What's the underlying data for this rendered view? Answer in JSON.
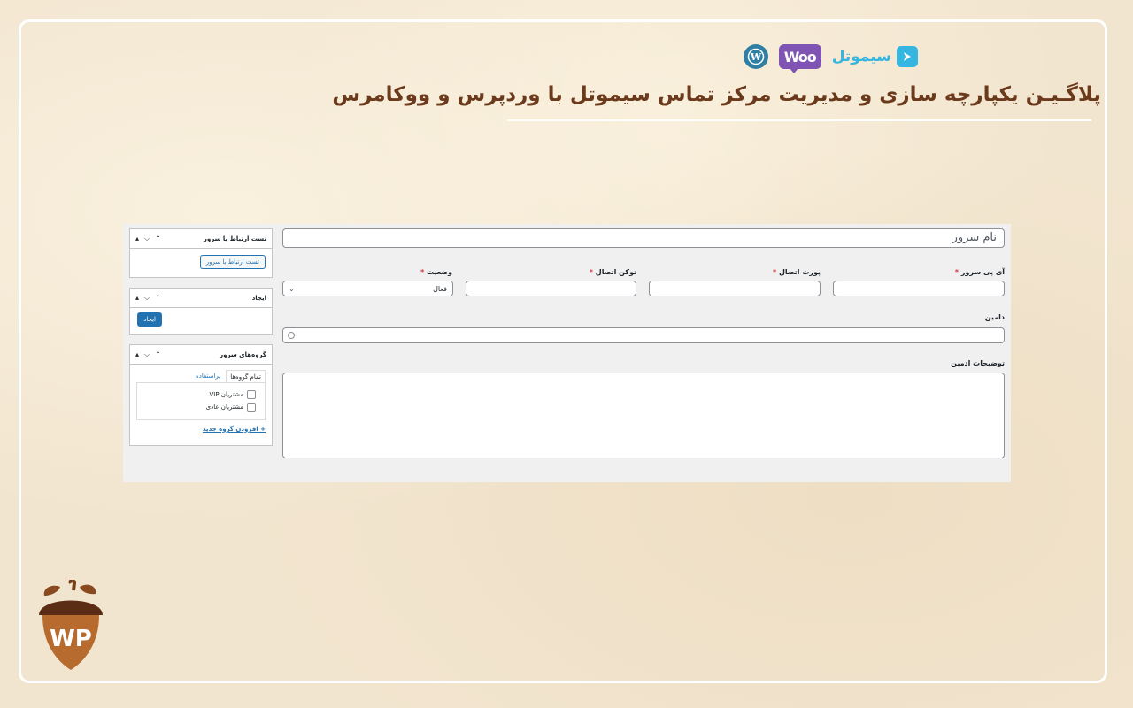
{
  "banner": {
    "brand_simotel": "سیموتل",
    "brand_woo": "Woo",
    "headline": "پلاگـیـن یکپارچه سازی و مدیریت مرکز تماس سیموتل با وردپرس و ووکامرس"
  },
  "form": {
    "title_placeholder": "نام سرور",
    "fields": {
      "ip_label": "آی پی سرور",
      "port_label": "پورت اتصال",
      "token_label": "توکن اتصال",
      "status_label": "وضعیت",
      "status_value": "فعال",
      "domain_label": "دامین",
      "notes_label": "توضیحات ادمین",
      "required_mark": "*"
    }
  },
  "sidebar": {
    "test_box": {
      "title": "تست ارتباط با سرور",
      "button": "تست ارتباط با سرور"
    },
    "publish_box": {
      "title": "ایجاد",
      "button": "ایجاد"
    },
    "groups_box": {
      "title": "گروه‌های سرور",
      "tab_all": "تمام گروه‌ها",
      "tab_most_used": "پراستفاده",
      "items": [
        {
          "label": "مشتریان VIP",
          "checked": false
        },
        {
          "label": "مشتریان عادی",
          "checked": false
        }
      ],
      "add_link": "+ افزودن گروه جدید"
    }
  },
  "watermark": {
    "logo_text": "WP"
  },
  "colors": {
    "headline": "#6b3a1c",
    "wp_blue": "#2271b1",
    "required_red": "#d63638",
    "woo_purple": "#7f54b3",
    "simotel_cyan": "#35b6e0"
  }
}
